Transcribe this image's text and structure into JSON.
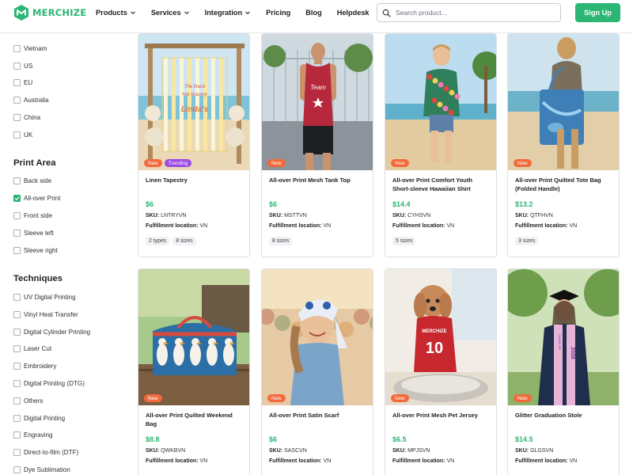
{
  "header": {
    "brand": "MERCHIZE",
    "nav": [
      {
        "label": "Products",
        "dropdown": true
      },
      {
        "label": "Services",
        "dropdown": true
      },
      {
        "label": "Integration",
        "dropdown": true
      },
      {
        "label": "Pricing",
        "dropdown": false
      },
      {
        "label": "Blog",
        "dropdown": false
      },
      {
        "label": "Helpdesk",
        "dropdown": false
      }
    ],
    "search_placeholder": "Search product...",
    "signup_label": "Sign Up",
    "accent": "#2bb673"
  },
  "sidebar": {
    "locations": [
      "Vietnam",
      "US",
      "EU",
      "Australia",
      "China",
      "UK"
    ],
    "print_area_title": "Print Area",
    "print_area": [
      {
        "label": "Back side",
        "checked": false
      },
      {
        "label": "All-over Print",
        "checked": true
      },
      {
        "label": "Front side",
        "checked": false
      },
      {
        "label": "Sleeve left",
        "checked": false
      },
      {
        "label": "Sleeve right",
        "checked": false
      }
    ],
    "techniques_title": "Techniques",
    "techniques": [
      "UV Digital Printing",
      "Vinyl Heat Transfer",
      "Digital Cylinder Printing",
      "Laser Cut",
      "Embroidery",
      "Digital Printing (DTG)",
      "Others",
      "Digital Printing",
      "Engraving",
      "Direct-to-film (DTF)",
      "Dye Sublimation"
    ]
  },
  "labels": {
    "sku": "SKU:",
    "fulfillment": "Fulfillment location:",
    "badge_new": "New",
    "badge_trending": "Trending"
  },
  "products": [
    {
      "name": "Linen Tapestry",
      "price": "$6",
      "sku": "LNTRYVN",
      "location": "VN",
      "badges": [
        "New",
        "Trending"
      ],
      "chips": [
        "2 types",
        "8 sizes"
      ],
      "image": "tapestry",
      "image_text": [
        "The finest",
        "Her bravery",
        "Linda's"
      ]
    },
    {
      "name": "All-over Print Mesh Tank Top",
      "price": "$6",
      "sku": "MSTTVN",
      "location": "VN",
      "badges": [
        "New"
      ],
      "chips": [
        "8 sizes"
      ],
      "image": "tanktop",
      "image_text": [
        "Team"
      ]
    },
    {
      "name": "All-over Print Comfort Youth Short-sleeve Hawaiian Shirt",
      "price": "$14.4",
      "sku": "CYHSVN",
      "location": "VN",
      "badges": [
        "New"
      ],
      "chips": [
        "5 sizes"
      ],
      "image": "hawaiian",
      "image_text": []
    },
    {
      "name": "All-over Print Quilted Tote Bag (Folded Handle)",
      "price": "$13.2",
      "sku": "QTFHVN",
      "location": "VN",
      "badges": [
        "New"
      ],
      "chips": [
        "3 sizes"
      ],
      "image": "tote",
      "image_text": []
    },
    {
      "name": "All-over Print Quilted Weekend Bag",
      "price": "$8.8",
      "sku": "QWKBVN",
      "location": "VN",
      "badges": [
        "New"
      ],
      "chips": [],
      "image": "weekend",
      "image_text": []
    },
    {
      "name": "All-over Print Satin Scarf",
      "price": "$6",
      "sku": "SASCVN",
      "location": "VN",
      "badges": [
        "New"
      ],
      "chips": [],
      "image": "scarf",
      "image_text": []
    },
    {
      "name": "All-over Print Mesh Pet Jersey",
      "price": "$6.5",
      "sku": "MPJSVN",
      "location": "VN",
      "badges": [
        "New"
      ],
      "chips": [],
      "image": "pet",
      "image_text": [
        "MERCHIZE",
        "10"
      ]
    },
    {
      "name": "Glitter Graduation Stole",
      "price": "$14.5",
      "sku": "GLGSVN",
      "location": "VN",
      "badges": [
        "New"
      ],
      "chips": [],
      "image": "stole",
      "image_text": [
        "CLASS OF",
        "2026"
      ]
    }
  ]
}
